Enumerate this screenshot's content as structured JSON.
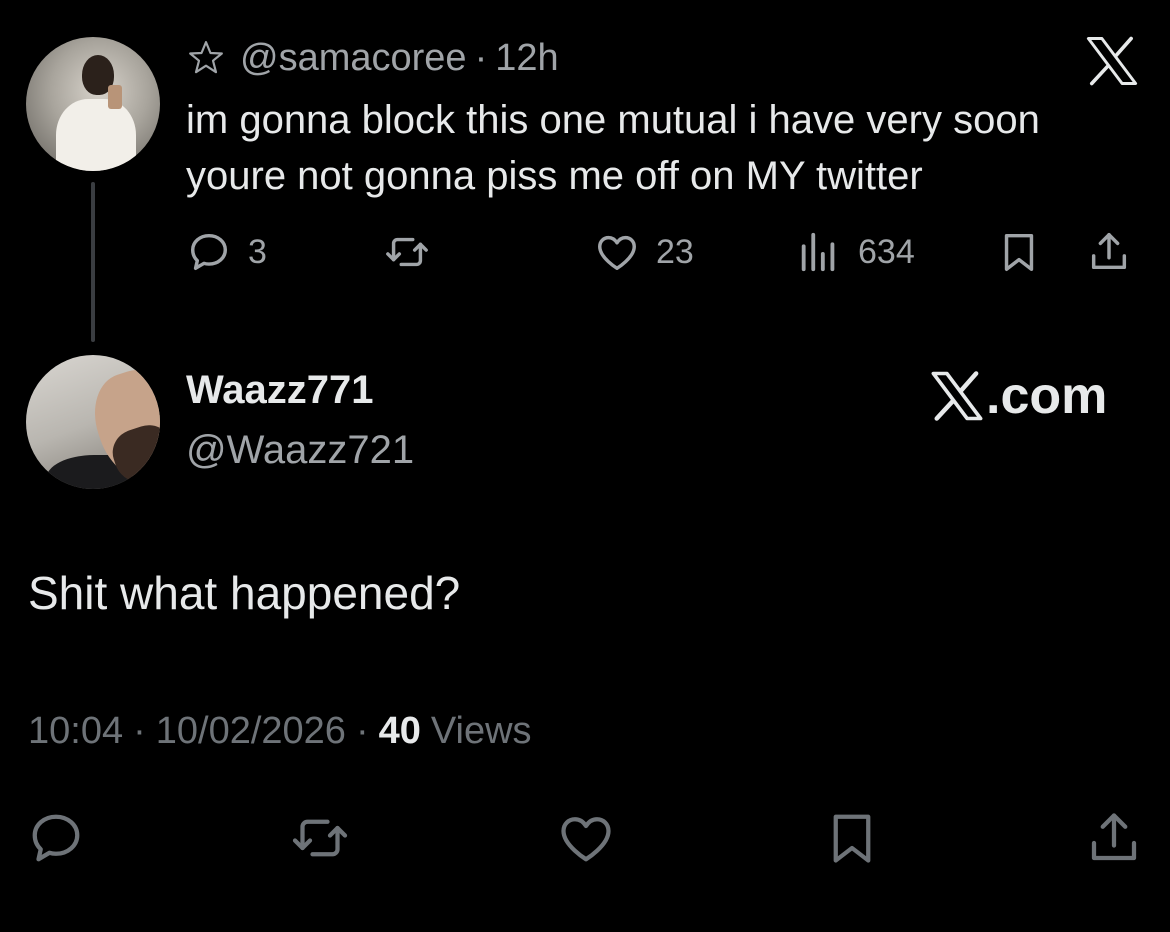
{
  "quoted_tweet": {
    "handle": "@samacoree",
    "separator": "·",
    "time": "12h",
    "text_lines": [
      "im gonna block this one mutual i have very soon",
      "youre not gonna piss me off on MY twitter"
    ],
    "reply_count": "3",
    "like_count": "23",
    "view_count": "634"
  },
  "main_tweet": {
    "display_name": "Waazz771",
    "handle": "@Waazz721",
    "brand": ".com",
    "text": "Shit what happened?",
    "time": "10:04",
    "separator": "·",
    "date": "10/02/2026",
    "views_count": "40",
    "views_label": "Views"
  },
  "icons": {
    "favorite": "star-icon",
    "platform_logo": "x-logo-icon",
    "reply": "reply-icon",
    "retweet": "retweet-icon",
    "like": "heart-icon",
    "views": "views-icon",
    "bookmark": "bookmark-icon",
    "share": "share-icon"
  },
  "colors": {
    "background": "#000000",
    "primary_text": "#e7e9ea",
    "secondary_text": "#a0a4a8",
    "muted_text": "#6e7378",
    "thread_line": "#3a3d41"
  }
}
